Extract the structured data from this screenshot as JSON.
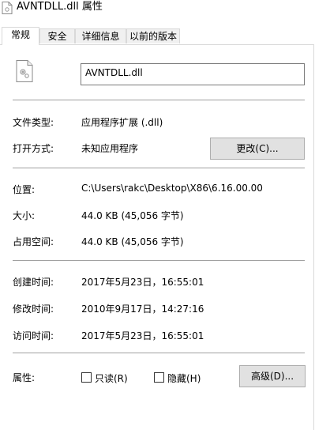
{
  "window": {
    "title": "AVNTDLL.dll 属性"
  },
  "tabs": [
    {
      "label": "常规"
    },
    {
      "label": "安全"
    },
    {
      "label": "详细信息"
    },
    {
      "label": "以前的版本"
    }
  ],
  "general": {
    "file_name": "AVNTDLL.dll",
    "file_type_label": "文件类型:",
    "file_type_value": "应用程序扩展 (.dll)",
    "opens_with_label": "打开方式:",
    "opens_with_value": "未知应用程序",
    "change_button": "更改(C)...",
    "location_label": "位置:",
    "location_value": "C:\\Users\\rakc\\Desktop\\X86\\6.16.00.00",
    "size_label": "大小:",
    "size_value": "44.0 KB (45,056 字节)",
    "size_on_disk_label": "占用空间:",
    "size_on_disk_value": "44.0 KB (45,056 字节)",
    "created_label": "创建时间:",
    "created_value": "2017年5月23日，16:55:01",
    "modified_label": "修改时间:",
    "modified_value": "2010年9月17日，14:27:16",
    "accessed_label": "访问时间:",
    "accessed_value": "2017年5月23日，16:55:01",
    "attributes_label": "属性:",
    "readonly_label": "只读(R)",
    "hidden_label": "隐藏(H)",
    "advanced_button": "高级(D)..."
  }
}
